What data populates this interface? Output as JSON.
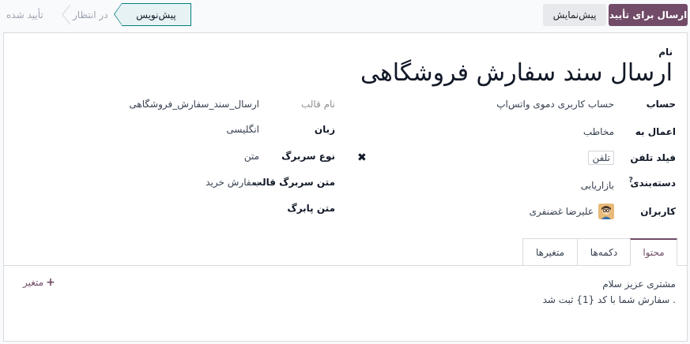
{
  "control_panel": {
    "primary_button": "ارسال برای تأیید",
    "preview_button": "پیش‌نمایش",
    "stages": {
      "done": "تأیید شده",
      "pending": "در انتظار",
      "current": "پیش‌نویس"
    }
  },
  "form": {
    "name_label": "نام",
    "name_value": "ارسال سند سفارش فروشگاهی",
    "right": {
      "account_label": "حساب",
      "account_value": "حساب کاربری دموی واتس‌اپ",
      "apply_to_label": "اعمال به",
      "apply_to_value": "مخاطب",
      "phone_field_label": "فیلد تلفن",
      "phone_field_value": "تلفن",
      "category_label": "دسته‌بندی",
      "category_help": "?",
      "category_value": "بازاریابی",
      "users_label": "کاربران",
      "users_value": "علیرضا غضنفری"
    },
    "left": {
      "template_name_label": "نام قالب",
      "template_name_value": "ارسال_سند_سفارش_فروشگاهی",
      "language_label": "زبان",
      "language_value": "انگلیسی",
      "header_type_label": "نوع سربرگ",
      "header_type_value": "متن",
      "header_text_label": "متن سربرگ قالب",
      "header_text_value": "سفارش خرید",
      "footer_label": "متن پابرگ"
    },
    "clear_icon": "close-icon"
  },
  "tabs": [
    {
      "label": "محتوا",
      "active": true
    },
    {
      "label": "دکمه‌ها",
      "active": false
    },
    {
      "label": "متغیرها",
      "active": false
    }
  ],
  "content": {
    "line1": "مشتری عزیز سلام",
    "line2": "سفارش شما با کد {1} ثبت شد .",
    "add_variable": "متغیر"
  },
  "colors": {
    "primary": "#714b67",
    "current_stage_border": "#017e84"
  }
}
